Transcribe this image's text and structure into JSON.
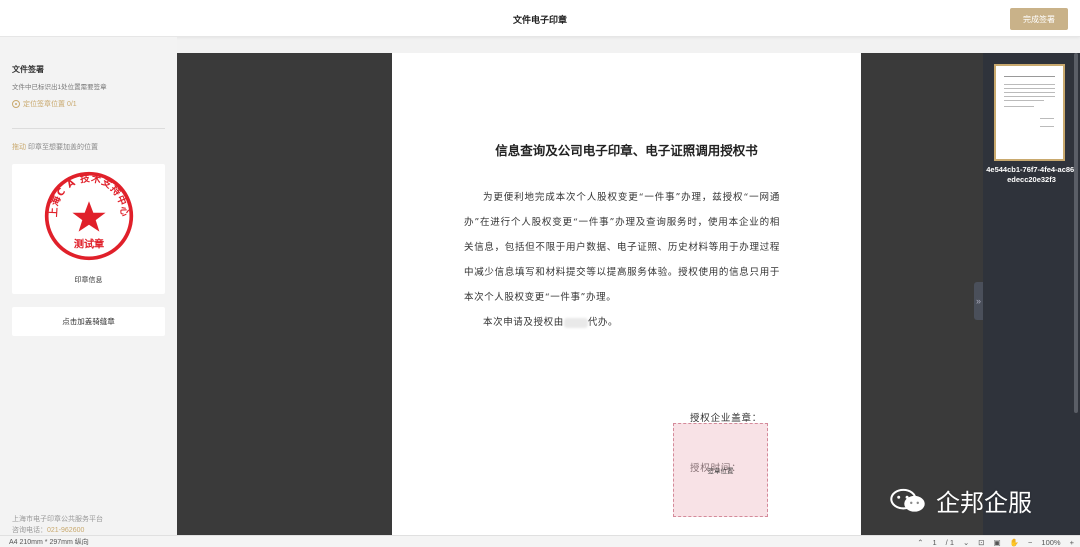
{
  "header": {
    "title": "文件电子印章",
    "complete_label": "完成签署"
  },
  "sidebar": {
    "sign_title": "文件签署",
    "sign_desc": "文件中已标识出1处位置需要签章",
    "locate_label": "定位签章位置 0/1",
    "drag_accent": "拖动",
    "drag_tip": "印章至想要加盖的位置",
    "seal": {
      "top_text": "上海C A 技术支持中心",
      "bottom_text": "测试章",
      "label": "印章信息",
      "color": "#e0202a"
    },
    "riding_seal_label": "点击加盖骑缝章",
    "platform": "上海市电子印章公共服务平台",
    "hotline_label": "咨询电话：",
    "hotline_number": "021-962600"
  },
  "document": {
    "title": "信息查询及公司电子印章、电子证照调用授权书",
    "paragraph1": "为更便利地完成本次个人股权变更“一件事”办理，兹授权“一网通办”在进行个人股权变更“一件事”办理及查询服务时，使用本企业的相关信息，包括但不限于用户数据、电子证照、历史材料等用于办理过程中减少信息填写和材料提交等以提高服务体验。授权使用的信息只用于本次个人股权变更“一件事”办理。",
    "paragraph2_start": "本次申请及授权由",
    "paragraph2_end": "代办。",
    "auth_seal_label": "授权企业盖章：",
    "auth_time_label": "授权时间：",
    "sign_area_label": "签章位置"
  },
  "thumbnails": {
    "file_name": "4e544cb1-76f7-4fe4-ac86-edecc20e32f3"
  },
  "watermark": {
    "text": "企邦企服"
  },
  "statusbar": {
    "page_size": "A4 210mm * 297mm 纵向",
    "page_current": "1",
    "page_total": "/ 1",
    "zoom": "100%"
  },
  "colors": {
    "accent": "#c9b289",
    "seal_red": "#e0202a",
    "dark_bg": "#3a3a3a"
  }
}
